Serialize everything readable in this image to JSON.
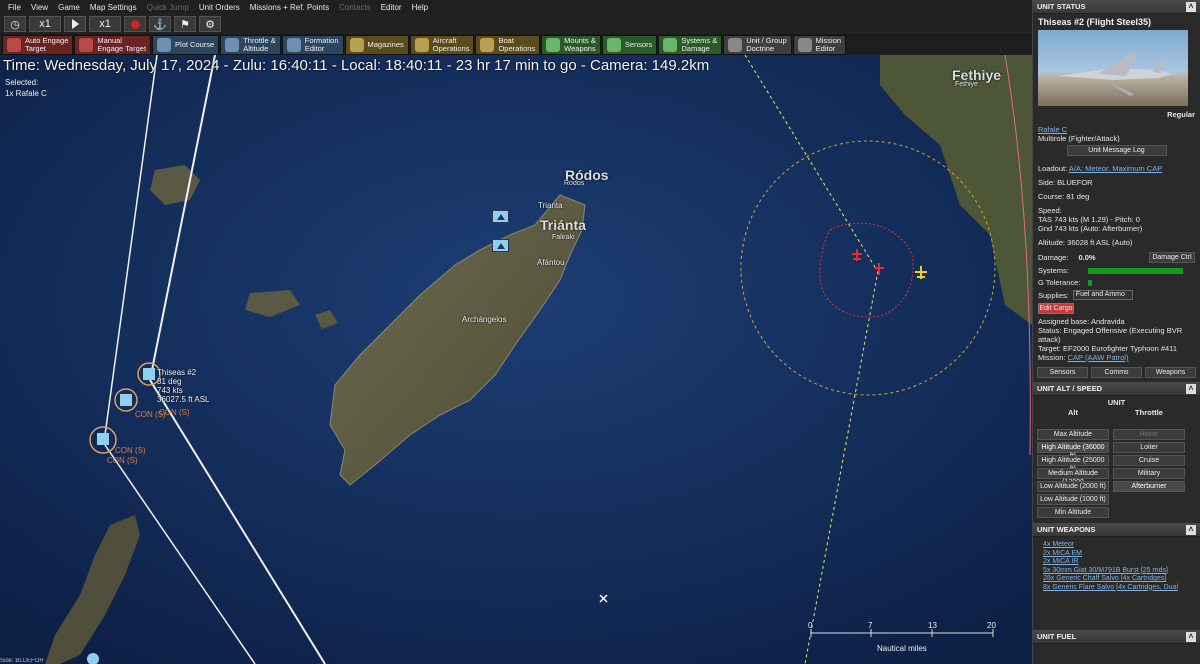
{
  "menu": [
    "File",
    "View",
    "Game",
    "Map Settings",
    "Quick Jump",
    "Unit Orders",
    "Missions + Ref. Points",
    "Contacts",
    "Editor",
    "Help"
  ],
  "menu_disabled": [
    4,
    7
  ],
  "time_controls": {
    "speed1": "x1",
    "speed2": "x1"
  },
  "toolbar": [
    {
      "label": "Auto Engage\nTarget",
      "color": "red"
    },
    {
      "label": "Manual\nEngage Target",
      "color": "red"
    },
    {
      "label": "Plot Course",
      "color": "blue"
    },
    {
      "label": "Throttle &\nAltitude",
      "color": "blue"
    },
    {
      "label": "Formation\nEditor",
      "color": "blue"
    },
    {
      "label": "Magazines",
      "color": "gold"
    },
    {
      "label": "Aircraft\nOperations",
      "color": "gold"
    },
    {
      "label": "Boat\nOperations",
      "color": "gold"
    },
    {
      "label": "Mounts &\nWeapons",
      "color": "green"
    },
    {
      "label": "Sensors",
      "color": "green"
    },
    {
      "label": "Systems &\nDamage",
      "color": "green"
    },
    {
      "label": "Unit / Group\nDoctrine",
      "color": "gray"
    },
    {
      "label": "Mission\nEditor",
      "color": "gray"
    }
  ],
  "map": {
    "timestamp": "Time: Wednesday, July 17, 2024 - Zulu: 16:40:11 - Local: 18:40:11 - 23 hr 17 min to go - Camera: 149.2km",
    "selected_label": "Selected:",
    "selected_unit": "1x Rafale C",
    "places": {
      "fethiye": "Fethiye",
      "fethiye_small": "Fethiye",
      "rodos": "Ródos",
      "rodos_small": "Rodos",
      "trianta": "Triánta",
      "trianta_small": "Trianta",
      "faliraki": "Faliraki",
      "afantou": "Afántou",
      "archangelos": "Archángelos"
    },
    "unit": {
      "name": "Thiseas #2",
      "course": "81 deg",
      "speed": "743 kts",
      "alt": "36027.5 ft ASL",
      "con1": "CON (S)",
      "con2": "CON (S)",
      "con3": "CON (S)",
      "con4": "CON (S)"
    },
    "scale": {
      "ticks": [
        "0",
        "7",
        "13",
        "20"
      ],
      "unit": "Nautical miles"
    },
    "status_line": "Side: BLUEFOR"
  },
  "panel": {
    "status_head": "UNIT STATUS",
    "unit_title": "Thiseas #2 (Flight Steel35)",
    "proficiency": "Regular",
    "class_link": "Rafale C",
    "role": "Multirole (Fighter/Attack)",
    "msg_log": "Unit Message Log",
    "loadout_label": "Loadout:",
    "loadout": "A/A: Meteor, Maximum CAP",
    "side": "Side: BLUEFOR",
    "course": "Course: 81 deg",
    "speed_label": "Speed:",
    "speed_tas": "TAS 743 kts (M 1.29) - Pitch: 0",
    "speed_gnd": "Gnd 743 kts (Auto: Afterburner)",
    "altitude": "Altitude: 36028 ft ASL (Auto)",
    "damage_label": "Damage:",
    "damage_value": "0.0%",
    "damage_btn": "Damage Ctrl",
    "systems_label": "Systems:",
    "g_label": "G Tolerance:",
    "supplies_label": "Supplies:",
    "supplies_value": "Fuel and Ammo",
    "edit_cargo": "Edit Cargo",
    "assigned_base": "Assigned base: Andravida",
    "status_text": "Status: Engaged Offensive (Executing BVR attack)",
    "target": "Target: EF2000 Eurofighter Typhoon #411",
    "mission_label": "Mission:",
    "mission": "CAP (AAW Patrol)",
    "tabs": [
      "Sensors",
      "Comms",
      "Weapons"
    ],
    "alt_head": "UNIT ALT / SPEED",
    "alt_unit": "UNIT",
    "alt_col": "Alt",
    "thr_col": "Throttle",
    "alt_buttons": [
      "Max Altitude",
      "High Altitude (36000 ft)",
      "High Altitude (25000 ft)",
      "Medium Altitude (12000",
      "Low Altitude (2000 ft)",
      "Low Altitude (1000 ft)",
      "Min Altitude"
    ],
    "thr_buttons": [
      "Hover",
      "Loiter",
      "Cruise",
      "Military",
      "Afterburner"
    ],
    "weapons_head": "UNIT WEAPONS",
    "weapons": [
      "4x Meteor",
      "2x MICA EM",
      "2x MICA IR",
      "5x 30mm Giat 30/M791B Burst [25 rnds]",
      "28x Generic Chaff Salvo [4x Cartridges]",
      "8x Generic Flare Salvo [4x Cartridges, Dual"
    ],
    "fuel_head": "UNIT FUEL"
  },
  "colors": {
    "accent_link": "#7fb3e6",
    "hostile": "#e03030",
    "friendly_marker": "#8fd0f0",
    "damage_bar": "#119a22"
  }
}
